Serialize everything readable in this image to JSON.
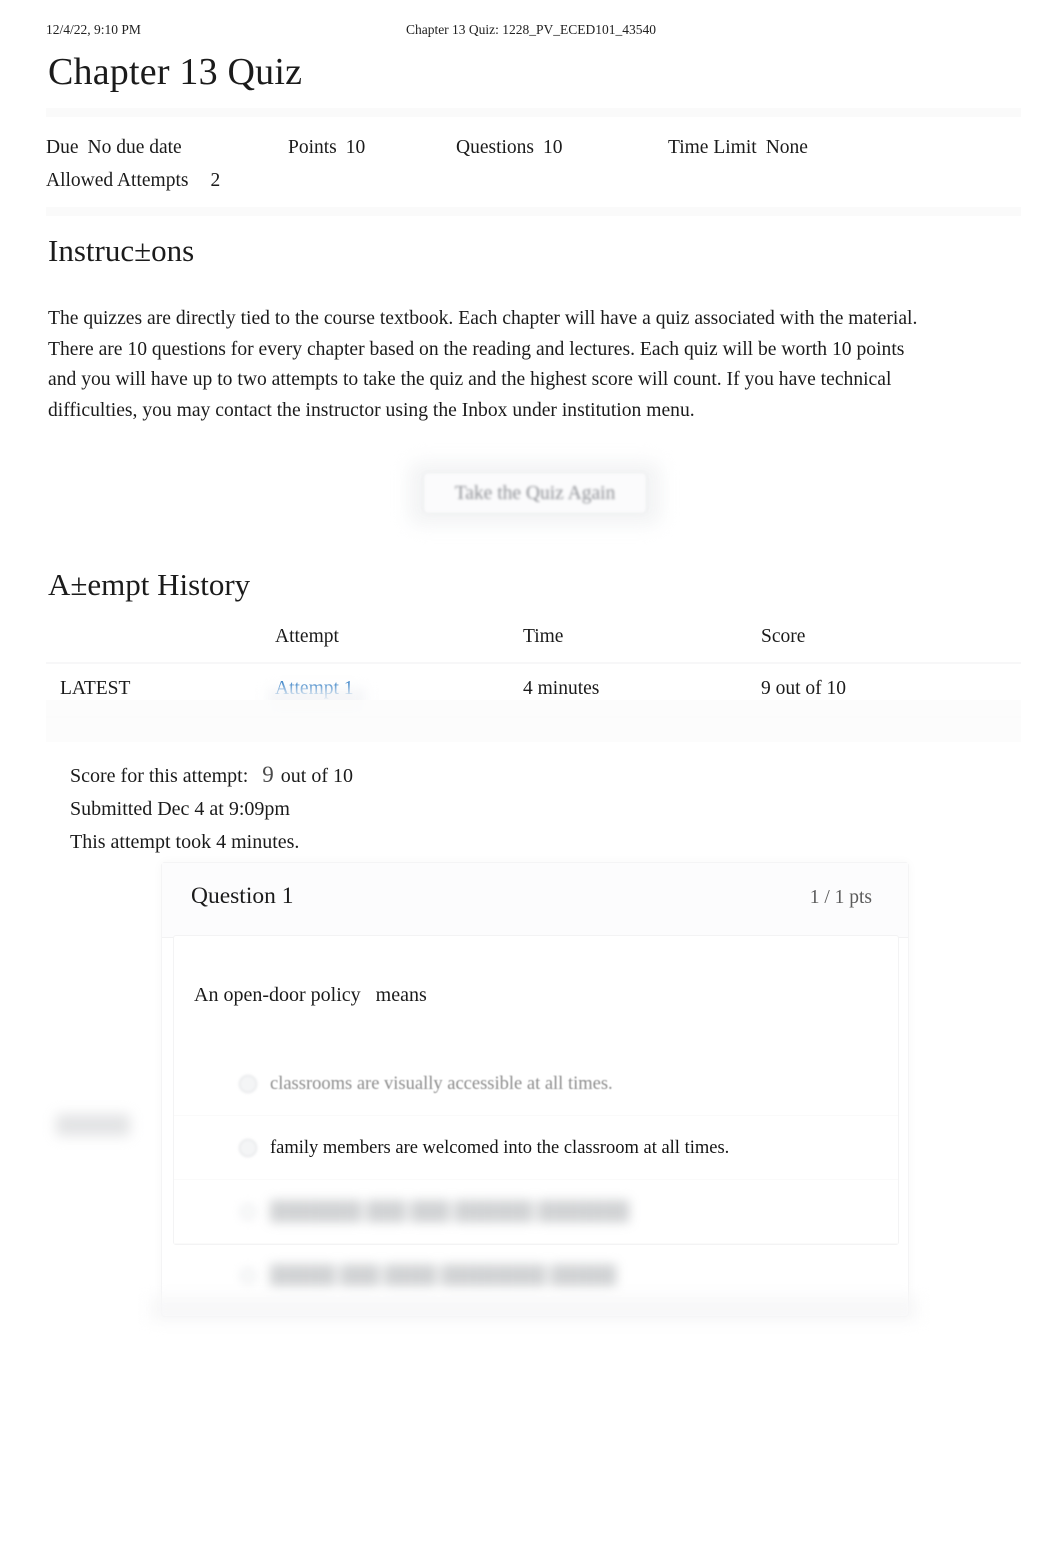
{
  "print_header": {
    "date": "12/4/22, 9:10 PM",
    "doc_title": "Chapter 13 Quiz: 1228_PV_ECED101_43540"
  },
  "quiz": {
    "title": "Chapter 13 Quiz",
    "meta": {
      "due_label": "Due",
      "due_value": "No due date",
      "points_label": "Points",
      "points_value": "10",
      "questions_label": "Questions",
      "questions_value": "10",
      "time_limit_label": "Time Limit",
      "time_limit_value": "None",
      "allowed_attempts_label": "Allowed Attempts",
      "allowed_attempts_value": "2"
    }
  },
  "instructions": {
    "heading": "Instruc±ons",
    "body": "The quizzes are directly tied to the course textbook. Each chapter will have a quiz associated with the material. There are 10 questions for every chapter based on the reading and lectures. Each quiz will be worth 10 points and you will have up to two attempts to take the quiz and the highest score will count. If you have technical difficulties, you may contact the instructor using the Inbox under institution menu."
  },
  "actions": {
    "retake_label": "Take the Quiz Again"
  },
  "attempt_history": {
    "heading": "A±empt History",
    "columns": {
      "kept": "",
      "attempt": "Attempt",
      "time": "Time",
      "score": "Score"
    },
    "rows": [
      {
        "kept": "LATEST",
        "attempt": "Attempt 1",
        "time": "4 minutes",
        "score": "9 out of 10"
      }
    ]
  },
  "attempt_summary": {
    "score_label": "Score for this attempt:",
    "score_value": "9",
    "score_suffix": "out of 10",
    "submitted": "Submitted Dec 4 at 9:09pm",
    "duration": "This attempt took 4 minutes."
  },
  "question": {
    "name": "Question 1",
    "points": "1 / 1 pts",
    "text": "An open-door policy   means",
    "options": [
      {
        "text": "classrooms are visually accessible at all times.",
        "legibility": "dim"
      },
      {
        "text": "family members are welcomed into the classroom at all times.",
        "legibility": "clear"
      },
      {
        "text": "███████ ███ ███ ██████ ███████",
        "legibility": "illegible"
      },
      {
        "text": "█████ ███ ████ ████████ █████",
        "legibility": "illegible"
      }
    ]
  },
  "colors": {
    "link": "#2f7cc4",
    "text": "#1b1b1b",
    "muted": "#5b5b5b",
    "dim": "#8d8d8d",
    "band": "#fafafa"
  }
}
